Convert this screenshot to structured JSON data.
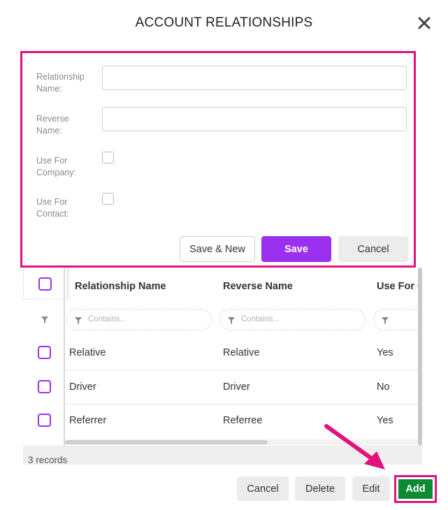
{
  "dialog": {
    "title": "ACCOUNT RELATIONSHIPS",
    "close_icon": "close-icon"
  },
  "form": {
    "fields": [
      {
        "label_line1": "Relationship",
        "label_line2": "Name:",
        "value": ""
      },
      {
        "label_line1": "Reverse",
        "label_line2": "Name:",
        "value": ""
      },
      {
        "label_line1": "Use For",
        "label_line2": "Company:",
        "checked": false
      },
      {
        "label_line1": "Use For",
        "label_line2": "Contact:",
        "checked": false
      }
    ],
    "buttons": {
      "save_new": "Save & New",
      "save": "Save",
      "cancel": "Cancel"
    }
  },
  "grid": {
    "columns": [
      "Relationship Name",
      "Reverse Name",
      "Use For C"
    ],
    "filter_placeholder": "Contains...",
    "rows": [
      {
        "name": "Relative",
        "reverse": "Relative",
        "use_for": "Yes"
      },
      {
        "name": "Driver",
        "reverse": "Driver",
        "use_for": "No"
      },
      {
        "name": "Referrer",
        "reverse": "Referree",
        "use_for": "Yes"
      }
    ],
    "records_label": "3 records"
  },
  "actions": {
    "cancel": "Cancel",
    "delete": "Delete",
    "edit": "Edit",
    "add": "Add"
  },
  "colors": {
    "highlight": "#e0127c",
    "primary": "#9b30f0",
    "add": "#0d8a34"
  }
}
